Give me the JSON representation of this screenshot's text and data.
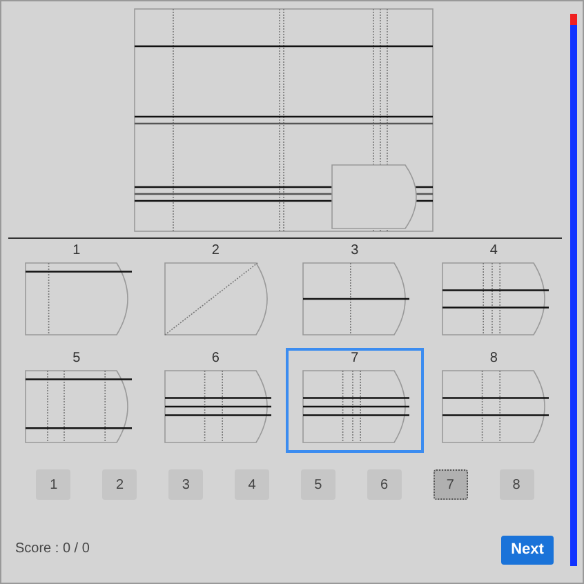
{
  "options": [
    {
      "label": "1",
      "selected": false
    },
    {
      "label": "2",
      "selected": false
    },
    {
      "label": "3",
      "selected": false
    },
    {
      "label": "4",
      "selected": false
    },
    {
      "label": "5",
      "selected": false
    },
    {
      "label": "6",
      "selected": false
    },
    {
      "label": "7",
      "selected": true
    },
    {
      "label": "8",
      "selected": false
    }
  ],
  "answers": [
    {
      "label": "1",
      "selected": false
    },
    {
      "label": "2",
      "selected": false
    },
    {
      "label": "3",
      "selected": false
    },
    {
      "label": "4",
      "selected": false
    },
    {
      "label": "5",
      "selected": false
    },
    {
      "label": "6",
      "selected": false
    },
    {
      "label": "7",
      "selected": true
    },
    {
      "label": "8",
      "selected": false
    }
  ],
  "score": "Score : 0 / 0",
  "next_button": "Next",
  "timer": {
    "level": 0.98
  }
}
